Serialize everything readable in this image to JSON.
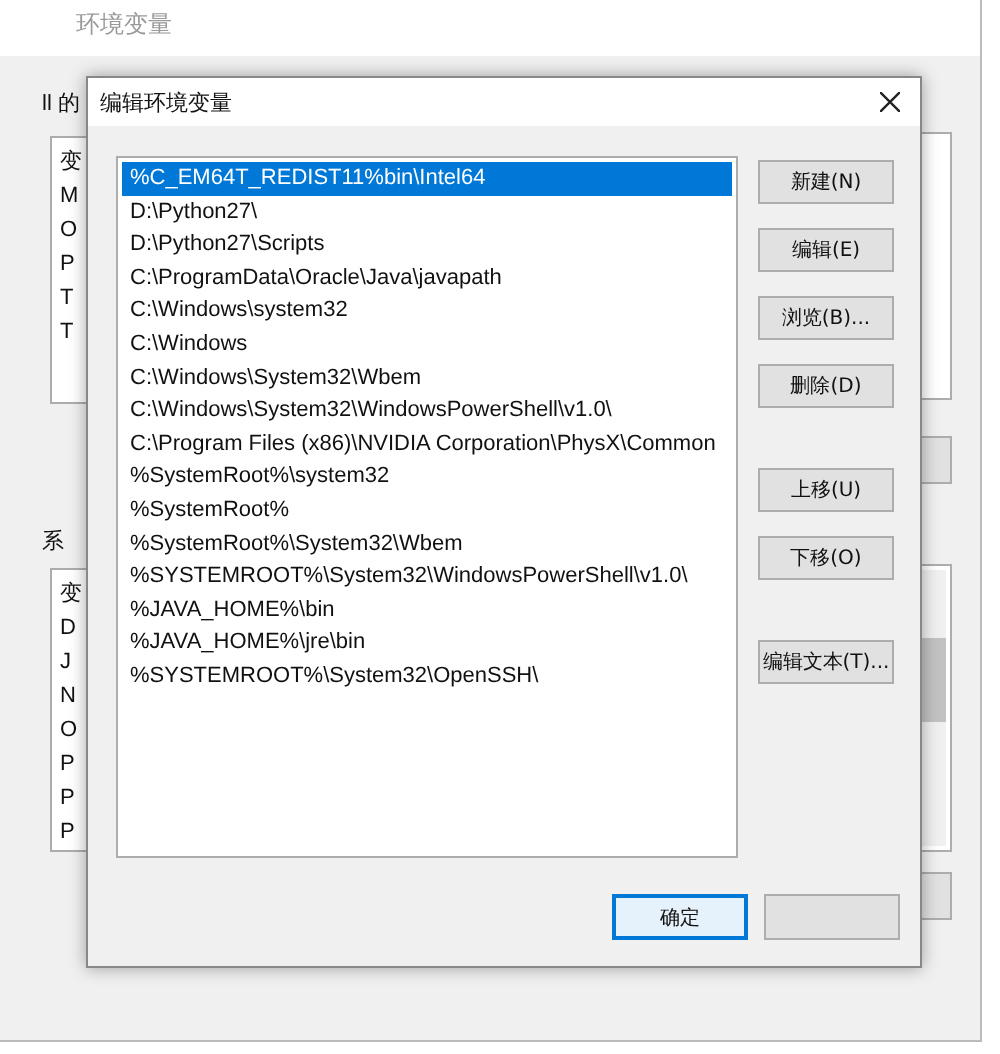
{
  "background_window": {
    "title": "环境变量",
    "user_group_label": "ll 的",
    "user_variables": [
      "变",
      "M",
      "O",
      "P",
      "T",
      "T"
    ],
    "system_group_label": "系",
    "system_variables": [
      "变",
      "D",
      "J",
      "N",
      "O",
      "P",
      "P",
      "P"
    ]
  },
  "dialog": {
    "title": "编辑环境变量",
    "entries": [
      {
        "text": "%C_EM64T_REDIST11%bin\\Intel64",
        "selected": true
      },
      {
        "text": "D:\\Python27\\",
        "selected": false
      },
      {
        "text": "D:\\Python27\\Scripts",
        "selected": false
      },
      {
        "text": "C:\\ProgramData\\Oracle\\Java\\javapath",
        "selected": false
      },
      {
        "text": "C:\\Windows\\system32",
        "selected": false
      },
      {
        "text": "C:\\Windows",
        "selected": false
      },
      {
        "text": "C:\\Windows\\System32\\Wbem",
        "selected": false
      },
      {
        "text": "C:\\Windows\\System32\\WindowsPowerShell\\v1.0\\",
        "selected": false
      },
      {
        "text": "C:\\Program Files (x86)\\NVIDIA Corporation\\PhysX\\Common",
        "selected": false
      },
      {
        "text": "%SystemRoot%\\system32",
        "selected": false
      },
      {
        "text": "%SystemRoot%",
        "selected": false
      },
      {
        "text": "%SystemRoot%\\System32\\Wbem",
        "selected": false
      },
      {
        "text": "%SYSTEMROOT%\\System32\\WindowsPowerShell\\v1.0\\",
        "selected": false
      },
      {
        "text": "%JAVA_HOME%\\bin",
        "selected": false
      },
      {
        "text": "%JAVA_HOME%\\jre\\bin",
        "selected": false
      },
      {
        "text": "%SYSTEMROOT%\\System32\\OpenSSH\\",
        "selected": false
      }
    ],
    "side_button_groups": [
      [
        "新建(N)",
        "编辑(E)",
        "浏览(B)...",
        "删除(D)"
      ],
      [
        "上移(U)",
        "下移(O)"
      ],
      [
        "编辑文本(T)..."
      ]
    ],
    "ok_button": "确定"
  }
}
